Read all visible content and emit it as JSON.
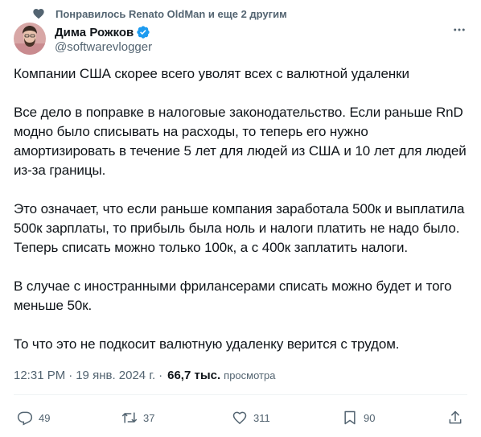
{
  "social_context": {
    "text": "Понравилось Renato OldMan и еще 2 другим"
  },
  "author": {
    "display_name": "Дима Рожков",
    "handle": "@softwarevlogger"
  },
  "tweet": {
    "paragraphs": [
      "Компании США скорее всего уволят всех с валютной удаленки",
      "Все дело в поправке в налоговые законодательство. Если раньше RnD модно было списывать на расходы, то теперь его нужно амортизировать в течение 5 лет для людей из США и 10 лет для людей из-за границы.",
      "Это означает, что если раньше компания заработала 500к и выплатила 500к зарплаты, то прибыль была ноль и налоги платить не надо было. Теперь списать можно только 100к, а с 400к заплатить налоги.",
      "В случае с иностранными фрилансерами списать можно будет и того меньше 50к.",
      "То что это не подкосит валютную удаленку верится с трудом."
    ],
    "time": "12:31 PM",
    "separator": "·",
    "date": "19 янв. 2024 г.",
    "views": "66,7 тыс.",
    "views_label": "просмотра"
  },
  "actions": {
    "replies": "49",
    "reposts": "37",
    "likes": "311",
    "bookmarks": "90"
  },
  "colors": {
    "secondary_text": "#536471",
    "primary_text": "#0f1419",
    "verified": "#1d9bf0"
  },
  "icons": [
    "heart-filled-icon",
    "verified-badge-icon",
    "more-icon",
    "reply-icon",
    "repost-icon",
    "like-icon",
    "bookmark-icon",
    "share-icon"
  ]
}
